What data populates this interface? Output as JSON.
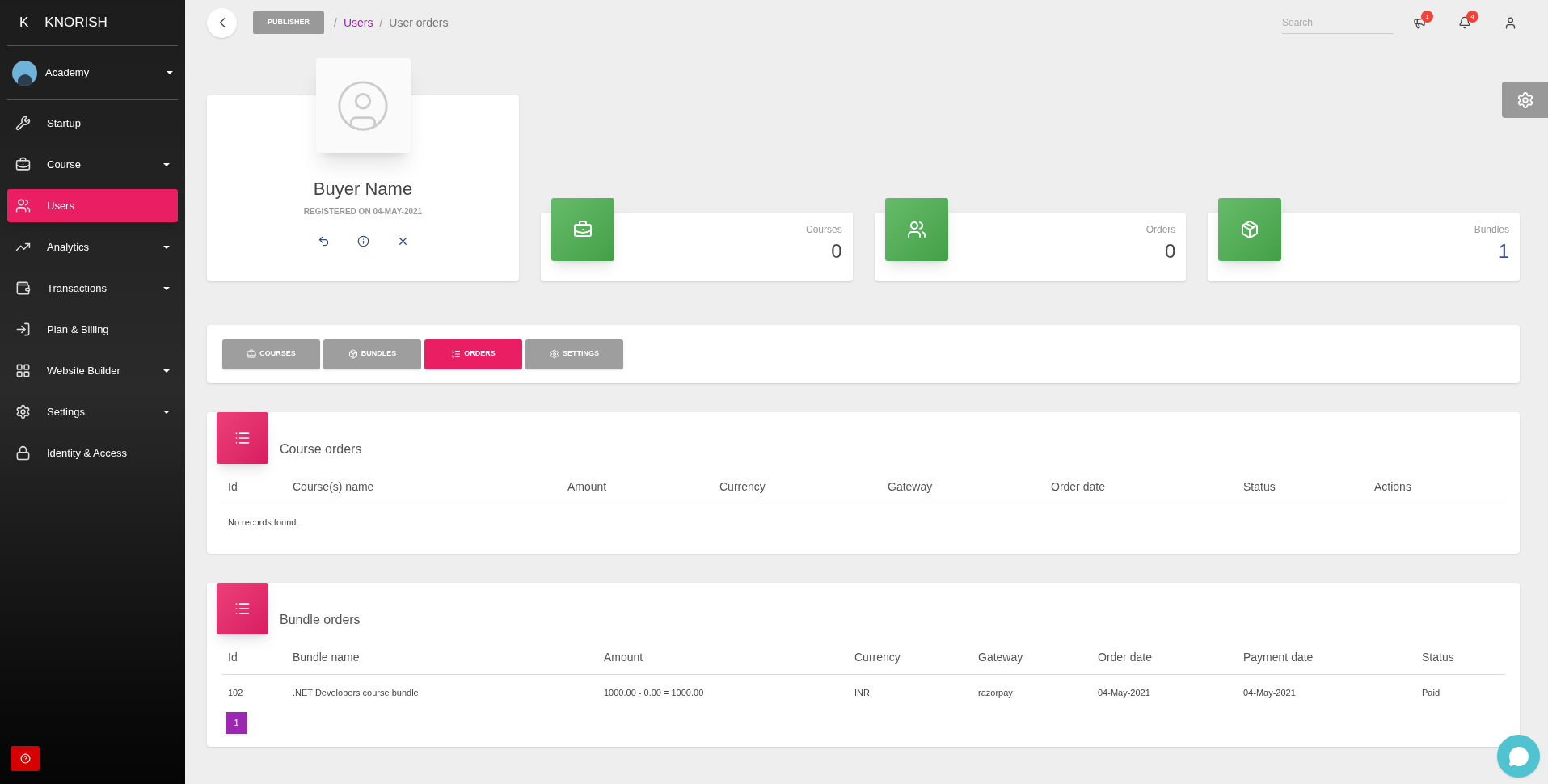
{
  "brand": {
    "letter": "K",
    "name": "KNORISH"
  },
  "account": {
    "name": "Academy"
  },
  "sidebar": {
    "items": [
      {
        "label": "Startup",
        "expandable": false,
        "selected": false
      },
      {
        "label": "Course",
        "expandable": true,
        "selected": false
      },
      {
        "label": "Users",
        "expandable": false,
        "selected": true
      },
      {
        "label": "Analytics",
        "expandable": true,
        "selected": false
      },
      {
        "label": "Transactions",
        "expandable": true,
        "selected": false
      },
      {
        "label": "Plan & Billing",
        "expandable": false,
        "selected": false
      },
      {
        "label": "Website Builder",
        "expandable": true,
        "selected": false
      },
      {
        "label": "Settings",
        "expandable": true,
        "selected": false
      },
      {
        "label": "Identity & Access",
        "expandable": false,
        "selected": false
      }
    ]
  },
  "topbar": {
    "role": "PUBLISHER",
    "breadcrumb": [
      {
        "kind": "separator",
        "label": "/"
      },
      {
        "kind": "link",
        "label": "Users"
      },
      {
        "kind": "separator",
        "label": "/"
      },
      {
        "kind": "current",
        "label": "User orders"
      }
    ],
    "search": {
      "placeholder": "Search"
    },
    "badges": [
      "1",
      "4"
    ]
  },
  "profile": {
    "name": "Buyer Name",
    "registered": "REGISTERED ON 04-MAY-2021"
  },
  "stats": [
    {
      "title": "Courses",
      "value": "0"
    },
    {
      "title": "Orders",
      "value": "0"
    },
    {
      "title": "Bundles",
      "value": "1"
    }
  ],
  "tabs": [
    {
      "label": "COURSES",
      "selected": false
    },
    {
      "label": "BUNDLES",
      "selected": false
    },
    {
      "label": "ORDERS",
      "selected": true
    },
    {
      "label": "SETTINGS",
      "selected": false
    }
  ],
  "course_orders": {
    "title": "Course orders",
    "columns": [
      "Id",
      "Course(s) name",
      "Amount",
      "Currency",
      "Gateway",
      "Order date",
      "Status",
      "Actions"
    ],
    "empty": "No records found."
  },
  "bundle_orders": {
    "title": "Bundle orders",
    "columns": [
      "Id",
      "Bundle name",
      "Amount",
      "Currency",
      "Gateway",
      "Order date",
      "Payment date",
      "Status"
    ],
    "rows": [
      [
        "102",
        ".NET Developers course bundle",
        "1000.00 - 0.00 = 1000.00",
        "INR",
        "razorpay",
        "04-May-2021",
        "04-May-2021",
        "Paid"
      ]
    ],
    "pages": [
      {
        "label": "1",
        "selected": true
      }
    ]
  }
}
